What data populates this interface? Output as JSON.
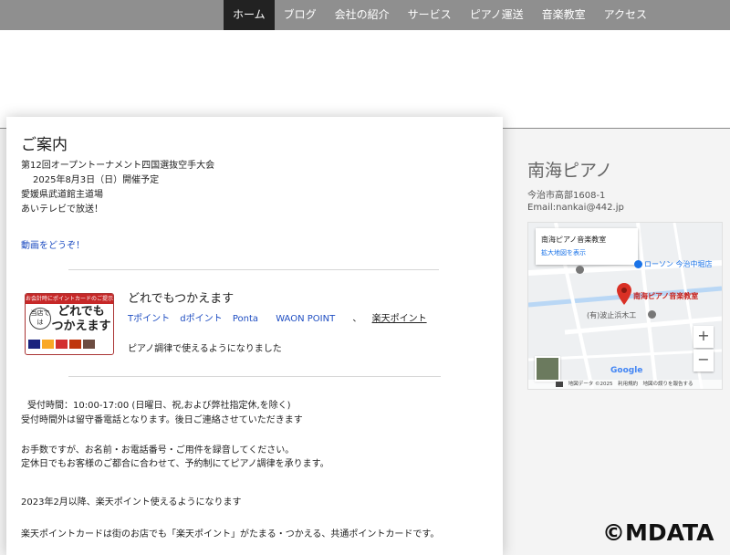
{
  "nav": {
    "items": [
      {
        "label": "ホーム",
        "active": true
      },
      {
        "label": "ブログ"
      },
      {
        "label": "会社の紹介"
      },
      {
        "label": "サービス"
      },
      {
        "label": "ピアノ運送"
      },
      {
        "label": "音楽教室"
      },
      {
        "label": "アクセス"
      }
    ]
  },
  "main": {
    "title": "ご案内",
    "event_line1": "第12回オープントーナメント四国選抜空手大会",
    "event_line2": "2025年8月3日（日）開催予定",
    "event_line3": "愛媛県武道館主道場",
    "event_line4": "あいテレビで放送！",
    "video_link": "動画をどうぞ！",
    "points": {
      "logo_top": "お会計時にポイントカードのご提示を！",
      "logo_badge": "当店では",
      "logo_main_1": "どれでも",
      "logo_main_2": "つかえます",
      "heading": "どれでもつかえます",
      "links": [
        "Tポイント",
        "dポイント",
        "Ponta",
        "WAON POINT"
      ],
      "separator": "、",
      "rakuten": "楽天ポイント",
      "note": "ピアノ調律で使えるようになりました"
    },
    "hours": "受付時間：10:00-17:00 (日曜日、祝,および弊社指定休,を除く)",
    "after_hours": "受付時間外は留守番電話となります。後日ご連絡させていただきます",
    "message1": "お手数ですが、お名前・お電話番号・ご用件を録音してください。",
    "message2": "定休日でもお客様のご都合に合わせて、予約制にてピアノ調律を承ります。",
    "rakuten_notice": "2023年2月以降、楽天ポイント使えるようになります",
    "rakuten_desc": "楽天ポイントカードは街のお店でも「楽天ポイント」がたまる・つかえる、共通ポイントカードです。"
  },
  "sidebar": {
    "title": "南海ピアノ",
    "address": "今治市高部1608-1",
    "email": "Email:nankai@442.jp",
    "map": {
      "info_title": "南海ピアノ音楽教室",
      "info_link": "拡大地図を表示",
      "label_lawson": "ローソン 今治中堀店",
      "label_pin": "南海ピアノ音楽教室",
      "label_company": "(有)波止浜木工",
      "zoom_in": "+",
      "zoom_out": "−",
      "google": "Google",
      "attribution": "地図データ ©2025　利用規約　地図の誤りを報告する"
    }
  },
  "watermark": "©MDATA"
}
